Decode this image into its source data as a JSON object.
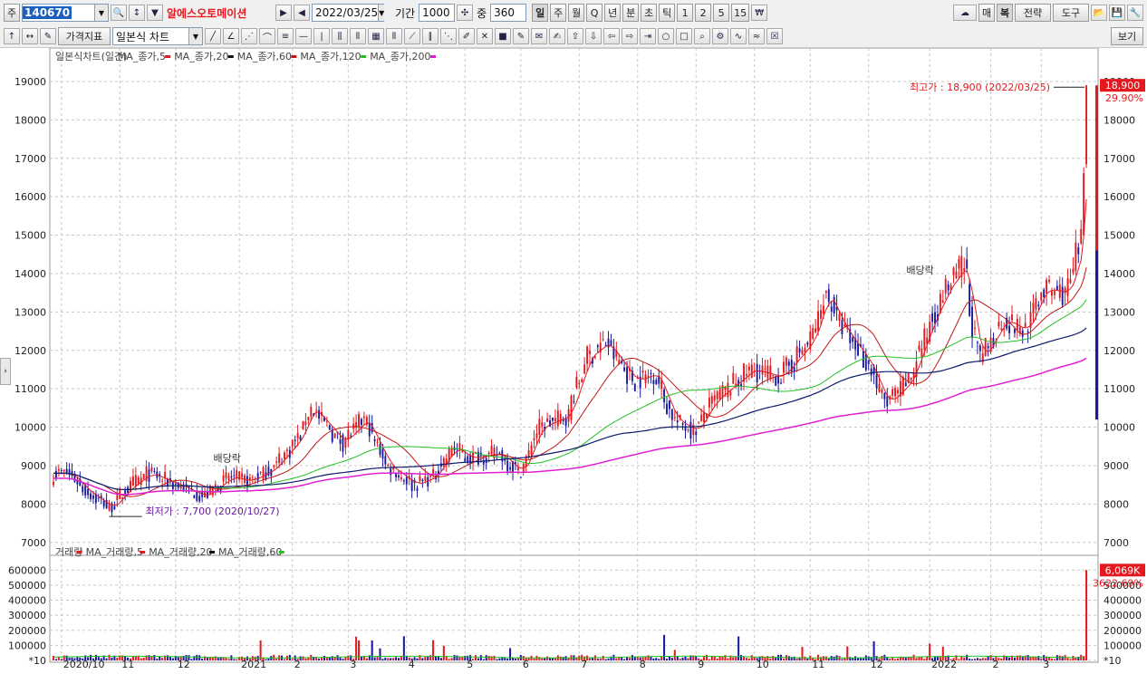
{
  "toolbar1": {
    "market_label": "주",
    "stock_code": "140670",
    "stock_name": "알에스오토메이션",
    "date": "2022/03/25",
    "period_label": "기간",
    "period_value": "1000",
    "count_label": "중",
    "count_value": "360",
    "period_buttons": [
      "일",
      "주",
      "월",
      "Q",
      "년",
      "분",
      "초",
      "틱",
      "1",
      "2",
      "5",
      "15"
    ],
    "selected_period": "일",
    "right_buttons": [
      "매",
      "복",
      "전략",
      "도구"
    ]
  },
  "toolbar2": {
    "indicator_button": "가격지표",
    "chart_type": "일본식 차트",
    "view_button": "보기"
  },
  "colors": {
    "up": "#e4181e",
    "down": "#1a1aa0",
    "ma5": "#e4181e",
    "ma20": "#111111",
    "ma60": "#c01818",
    "ma120": "#22c022",
    "ma200": "#0e1a6e",
    "ma_last": "#e020d0",
    "vol_ma60": "#22c022"
  },
  "chart_data": {
    "type": "candlestick",
    "price_panel": {
      "legend": [
        "일본식차트(일간)",
        "MA_종가,5",
        "MA_종가,20",
        "MA_종가,60",
        "MA_종가,120",
        "MA_종가,200"
      ],
      "ylim": [
        6900,
        19400
      ],
      "y_ticks": [
        7000,
        8000,
        9000,
        10000,
        11000,
        12000,
        13000,
        14000,
        15000,
        16000,
        17000,
        18000,
        19000
      ],
      "y_tick_labels": [
        "7000",
        "8000",
        "9000",
        "10000",
        "11000",
        "12000",
        "13000",
        "14000",
        "15000",
        "16000",
        "17000",
        "18000",
        "19000"
      ],
      "max_annotation": "최고가 : 18,900 (2022/03/25)",
      "min_annotation": "최저가 : 7,700 (2020/10/27)",
      "dividend_labels": [
        "배당락",
        "배당락"
      ],
      "last_price_label": "18,900",
      "last_change_label": "29.90%",
      "close_anchors": [
        [
          "2020-10-05",
          8800
        ],
        [
          "2020-10-15",
          8300
        ],
        [
          "2020-10-27",
          7900
        ],
        [
          "2020-11-05",
          8400
        ],
        [
          "2020-11-16",
          8800
        ],
        [
          "2020-12-01",
          8500
        ],
        [
          "2020-12-15",
          8200
        ],
        [
          "2020-12-29",
          8700
        ],
        [
          "2021-01-08",
          8600
        ],
        [
          "2021-01-20",
          8900
        ],
        [
          "2021-02-03",
          9700
        ],
        [
          "2021-02-10",
          10500
        ],
        [
          "2021-02-26",
          9600
        ],
        [
          "2021-03-10",
          10200
        ],
        [
          "2021-03-22",
          9000
        ],
        [
          "2021-04-05",
          8500
        ],
        [
          "2021-04-15",
          8700
        ],
        [
          "2021-04-26",
          9500
        ],
        [
          "2021-05-03",
          9200
        ],
        [
          "2021-05-20",
          9300
        ],
        [
          "2021-05-31",
          8800
        ],
        [
          "2021-06-10",
          10000
        ],
        [
          "2021-06-25",
          10300
        ],
        [
          "2021-07-05",
          11800
        ],
        [
          "2021-07-15",
          12200
        ],
        [
          "2021-07-30",
          11200
        ],
        [
          "2021-08-10",
          11400
        ],
        [
          "2021-08-20",
          10200
        ],
        [
          "2021-08-31",
          9900
        ],
        [
          "2021-09-10",
          10700
        ],
        [
          "2021-09-30",
          11500
        ],
        [
          "2021-10-15",
          11300
        ],
        [
          "2021-11-01",
          12300
        ],
        [
          "2021-11-08",
          13500
        ],
        [
          "2021-11-18",
          12500
        ],
        [
          "2021-11-30",
          11700
        ],
        [
          "2021-12-10",
          10600
        ],
        [
          "2021-12-22",
          11200
        ],
        [
          "2022-01-03",
          12800
        ],
        [
          "2022-01-12",
          13700
        ],
        [
          "2022-01-20",
          14200
        ],
        [
          "2022-01-28",
          11700
        ],
        [
          "2022-02-10",
          12800
        ],
        [
          "2022-02-21",
          12500
        ],
        [
          "2022-03-03",
          13600
        ],
        [
          "2022-03-15",
          13500
        ],
        [
          "2022-03-23",
          14800
        ],
        [
          "2022-03-25",
          18900
        ]
      ]
    },
    "volume_panel": {
      "legend": [
        "거래량",
        "MA_거래량,5",
        "MA_거래량,20",
        "MA_거래량,60"
      ],
      "ylim": [
        0,
        650000
      ],
      "y_ticks": [
        0,
        100000,
        200000,
        300000,
        400000,
        500000,
        600000
      ],
      "y_tick_labels": [
        "*10",
        "100000",
        "200000",
        "300000",
        "400000",
        "500000",
        "600000"
      ],
      "last_volume_label": "6,069K",
      "last_volume_change_label": "3622.69%",
      "last_volume": 600000
    },
    "x_labels": [
      {
        "date": "2020-10-01",
        "label": "2020/10"
      },
      {
        "date": "2020-11-02",
        "label": "11"
      },
      {
        "date": "2020-12-01",
        "label": "12"
      },
      {
        "date": "2021-01-04",
        "label": "2021"
      },
      {
        "date": "2021-02-01",
        "label": "2"
      },
      {
        "date": "2021-03-02",
        "label": "3"
      },
      {
        "date": "2021-04-01",
        "label": "4"
      },
      {
        "date": "2021-05-03",
        "label": "5"
      },
      {
        "date": "2021-06-01",
        "label": "6"
      },
      {
        "date": "2021-07-01",
        "label": "7"
      },
      {
        "date": "2021-08-02",
        "label": "8"
      },
      {
        "date": "2021-09-01",
        "label": "9"
      },
      {
        "date": "2021-10-01",
        "label": "10"
      },
      {
        "date": "2021-11-01",
        "label": "11"
      },
      {
        "date": "2021-12-01",
        "label": "12"
      },
      {
        "date": "2022-01-03",
        "label": "2022"
      },
      {
        "date": "2022-02-03",
        "label": "2"
      },
      {
        "date": "2022-03-02",
        "label": "3"
      }
    ]
  }
}
